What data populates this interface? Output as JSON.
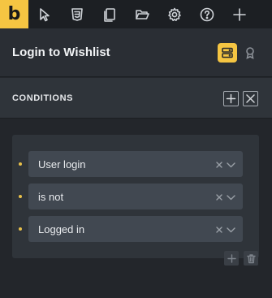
{
  "toolbar": {
    "logo": "b",
    "icons": [
      "cursor-icon",
      "css3-icon",
      "copy-icon",
      "folder-open-icon",
      "gear-icon",
      "help-icon",
      "plus-icon"
    ]
  },
  "header": {
    "title": "Login to Wishlist"
  },
  "conditions": {
    "section_title": "CONDITIONS",
    "rows": [
      {
        "value": "User login"
      },
      {
        "value": "is not"
      },
      {
        "value": "Logged in"
      }
    ]
  },
  "colors": {
    "accent": "#f5c542",
    "background": "#23262b",
    "panel": "#2f343a",
    "select": "#414851"
  }
}
